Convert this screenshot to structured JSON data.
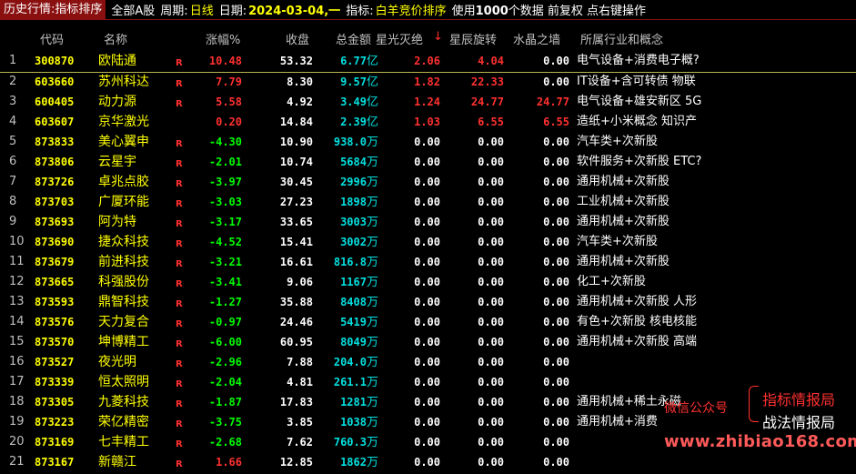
{
  "topbar": {
    "title": "历史行情:指标排序",
    "market": "全部A股",
    "period_label": "周期:",
    "period_value": "日线",
    "date_label": "日期:",
    "date_value": "2024-03-04,一",
    "indicator_label": "指标:",
    "indicator_value": "白羊竞价排序",
    "data_note_prefix": "使用",
    "data_count": "1000",
    "data_note_suffix": "个数据 前复权 点右键操作"
  },
  "header": {
    "code": "代码",
    "name": "名称",
    "chg": "涨幅%",
    "close": "收盘",
    "amount": "总金额",
    "star": "星光灭绝",
    "sort_arrow": "↓",
    "rotate": "星辰旋转",
    "wall": "水晶之墙",
    "industry": "所属行业和概念"
  },
  "rows": [
    {
      "idx": "1",
      "code": "300870",
      "name": "欧陆通",
      "r": "R",
      "chg": "10.48",
      "close": "53.32",
      "amt": "6.77",
      "unit": "亿",
      "star": "2.06",
      "rot": "4.04",
      "wall": "0.00",
      "ind": "电气设备+消费电子概?"
    },
    {
      "idx": "2",
      "code": "603660",
      "name": "苏州科达",
      "r": "R",
      "chg": "7.79",
      "close": "8.30",
      "amt": "9.57",
      "unit": "亿",
      "star": "1.82",
      "rot": "22.33",
      "wall": "0.00",
      "ind": "IT设备+含可转债 物联"
    },
    {
      "idx": "3",
      "code": "600405",
      "name": "动力源",
      "r": "R",
      "chg": "5.58",
      "close": "4.92",
      "amt": "3.49",
      "unit": "亿",
      "star": "1.24",
      "rot": "24.77",
      "wall": "24.77",
      "ind": "电气设备+雄安新区 5G"
    },
    {
      "idx": "4",
      "code": "603607",
      "name": "京华激光",
      "r": "",
      "chg": "0.20",
      "close": "14.84",
      "amt": "2.39",
      "unit": "亿",
      "star": "1.03",
      "rot": "6.55",
      "wall": "6.55",
      "ind": "造纸+小米概念 知识产"
    },
    {
      "idx": "5",
      "code": "873833",
      "name": "美心翼申",
      "r": "R",
      "chg": "-4.30",
      "close": "10.90",
      "amt": "938.0",
      "unit": "万",
      "star": "0.00",
      "rot": "0.00",
      "wall": "0.00",
      "ind": "汽车类+次新股"
    },
    {
      "idx": "6",
      "code": "873806",
      "name": "云星宇",
      "r": "R",
      "chg": "-2.01",
      "close": "10.74",
      "amt": "5684",
      "unit": "万",
      "star": "0.00",
      "rot": "0.00",
      "wall": "0.00",
      "ind": "软件服务+次新股 ETC?"
    },
    {
      "idx": "7",
      "code": "873726",
      "name": "卓兆点胶",
      "r": "R",
      "chg": "-3.97",
      "close": "30.45",
      "amt": "2996",
      "unit": "万",
      "star": "0.00",
      "rot": "0.00",
      "wall": "0.00",
      "ind": "通用机械+次新股"
    },
    {
      "idx": "8",
      "code": "873703",
      "name": "广厦环能",
      "r": "R",
      "chg": "-3.03",
      "close": "27.23",
      "amt": "1898",
      "unit": "万",
      "star": "0.00",
      "rot": "0.00",
      "wall": "0.00",
      "ind": "工业机械+次新股"
    },
    {
      "idx": "9",
      "code": "873693",
      "name": "阿为特",
      "r": "R",
      "chg": "-3.17",
      "close": "33.65",
      "amt": "3003",
      "unit": "万",
      "star": "0.00",
      "rot": "0.00",
      "wall": "0.00",
      "ind": "通用机械+次新股"
    },
    {
      "idx": "10",
      "code": "873690",
      "name": "捷众科技",
      "r": "R",
      "chg": "-4.52",
      "close": "15.41",
      "amt": "3002",
      "unit": "万",
      "star": "0.00",
      "rot": "0.00",
      "wall": "0.00",
      "ind": "汽车类+次新股"
    },
    {
      "idx": "11",
      "code": "873679",
      "name": "前进科技",
      "r": "R",
      "chg": "-3.21",
      "close": "16.61",
      "amt": "816.8",
      "unit": "万",
      "star": "0.00",
      "rot": "0.00",
      "wall": "0.00",
      "ind": "通用机械+次新股"
    },
    {
      "idx": "12",
      "code": "873665",
      "name": "科强股份",
      "r": "R",
      "chg": "-3.41",
      "close": "9.06",
      "amt": "1167",
      "unit": "万",
      "star": "0.00",
      "rot": "0.00",
      "wall": "0.00",
      "ind": "化工+次新股"
    },
    {
      "idx": "13",
      "code": "873593",
      "name": "鼎智科技",
      "r": "R",
      "chg": "-1.27",
      "close": "35.88",
      "amt": "8408",
      "unit": "万",
      "star": "0.00",
      "rot": "0.00",
      "wall": "0.00",
      "ind": "通用机械+次新股 人形"
    },
    {
      "idx": "14",
      "code": "873576",
      "name": "天力复合",
      "r": "R",
      "chg": "-0.97",
      "close": "24.46",
      "amt": "5419",
      "unit": "万",
      "star": "0.00",
      "rot": "0.00",
      "wall": "0.00",
      "ind": "有色+次新股 核电核能"
    },
    {
      "idx": "15",
      "code": "873570",
      "name": "坤博精工",
      "r": "R",
      "chg": "-6.00",
      "close": "60.95",
      "amt": "8049",
      "unit": "万",
      "star": "0.00",
      "rot": "0.00",
      "wall": "0.00",
      "ind": "通用机械+次新股 高端"
    },
    {
      "idx": "16",
      "code": "873527",
      "name": "夜光明",
      "r": "R",
      "chg": "-2.96",
      "close": "7.88",
      "amt": "204.0",
      "unit": "万",
      "star": "0.00",
      "rot": "0.00",
      "wall": "0.00",
      "ind": ""
    },
    {
      "idx": "17",
      "code": "873339",
      "name": "恒太照明",
      "r": "R",
      "chg": "-2.04",
      "close": "4.81",
      "amt": "261.1",
      "unit": "万",
      "star": "0.00",
      "rot": "0.00",
      "wall": "0.00",
      "ind": ""
    },
    {
      "idx": "18",
      "code": "873305",
      "name": "九菱科技",
      "r": "R",
      "chg": "-1.87",
      "close": "17.83",
      "amt": "1281",
      "unit": "万",
      "star": "0.00",
      "rot": "0.00",
      "wall": "0.00",
      "ind": "通用机械+稀土永磁"
    },
    {
      "idx": "19",
      "code": "873223",
      "name": "荣亿精密",
      "r": "R",
      "chg": "-3.75",
      "close": "3.85",
      "amt": "1038",
      "unit": "万",
      "star": "0.00",
      "rot": "0.00",
      "wall": "0.00",
      "ind": "通用机械+消费"
    },
    {
      "idx": "20",
      "code": "873169",
      "name": "七丰精工",
      "r": "R",
      "chg": "-2.68",
      "close": "7.62",
      "amt": "760.3",
      "unit": "万",
      "star": "0.00",
      "rot": "0.00",
      "wall": "0.00",
      "ind": ""
    },
    {
      "idx": "21",
      "code": "873167",
      "name": "新赣江",
      "r": "R",
      "chg": "1.66",
      "close": "12.85",
      "amt": "1862",
      "unit": "万",
      "star": "0.00",
      "rot": "0.00",
      "wall": "0.00",
      "ind": ""
    }
  ],
  "watermark": {
    "wechat_label": "微信公众号",
    "line1": "指标情报局",
    "line2": "战法情报局",
    "url": "www.zhibiao168.com"
  },
  "colors": {
    "up": "#ff3030",
    "down": "#00ff00",
    "neutral": "#ffffff",
    "amount": "#00e0e0",
    "code": "#ffff00"
  }
}
